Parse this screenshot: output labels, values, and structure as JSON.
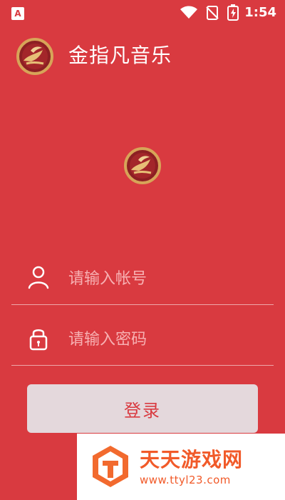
{
  "status_bar": {
    "left_icon": "A",
    "time": "1:54"
  },
  "header": {
    "title": "金指凡音乐"
  },
  "login_form": {
    "account_placeholder": "请输入帐号",
    "password_placeholder": "请输入密码",
    "login_button": "登录"
  },
  "watermark": {
    "title": "天天游戏网",
    "url": "www.ttyl23.com"
  },
  "icons": {
    "header_logo": "app-logo-icon",
    "center_logo": "app-logo-icon",
    "account": "user-icon",
    "password": "lock-icon",
    "wifi": "wifi-icon",
    "signal": "no-signal-icon",
    "battery": "battery-charging-icon",
    "watermark_logo": "watermark-logo-icon"
  },
  "colors": {
    "background": "#d93a40",
    "button_background": "#e4d8dc",
    "button_text": "#d93a40",
    "watermark_orange": "#f15a29"
  }
}
